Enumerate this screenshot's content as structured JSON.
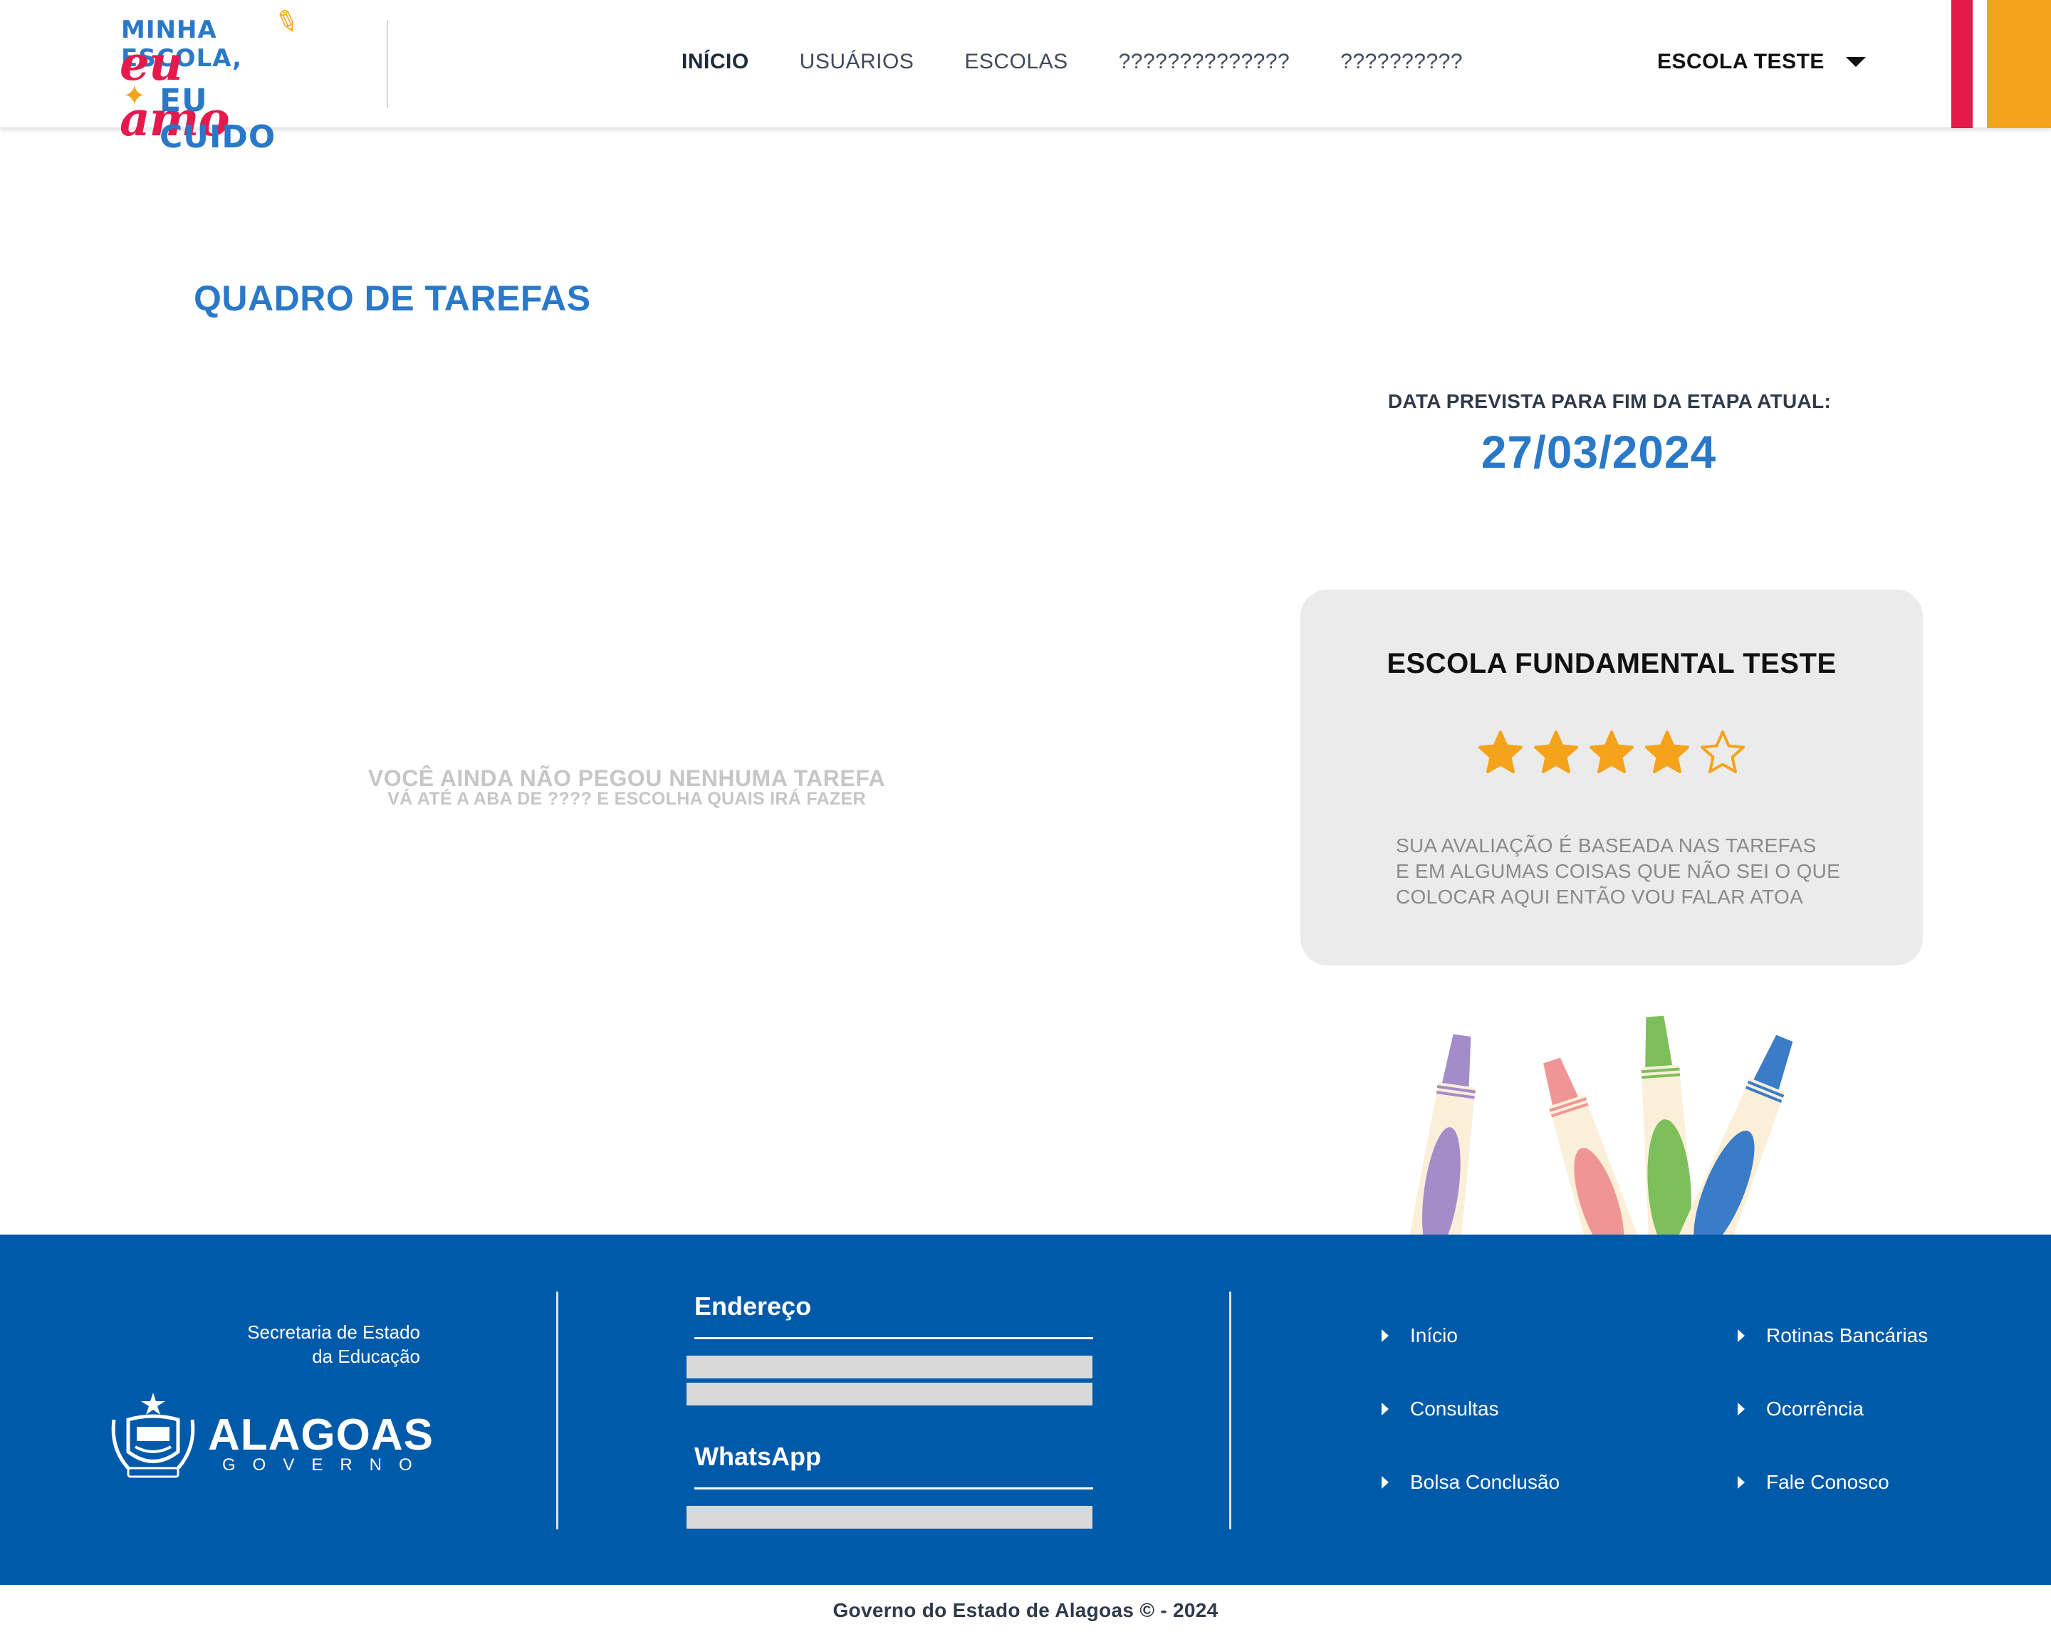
{
  "header": {
    "logo": {
      "line1": "MINHA ESCOLA,",
      "line2": "eu amo",
      "line3": "EU CUIDO"
    },
    "nav": [
      {
        "label": "INÍCIO",
        "active": true
      },
      {
        "label": "USUÁRIOS",
        "active": false
      },
      {
        "label": "ESCOLAS",
        "active": false
      },
      {
        "label": "??????????????",
        "active": false
      },
      {
        "label": "??????????",
        "active": false
      }
    ],
    "school_selector": {
      "label": "ESCOLA TESTE",
      "icon": "caret-down-icon"
    },
    "accent_colors": {
      "red": "#e5194c",
      "orange": "#f5a31a"
    }
  },
  "main": {
    "title": "QUADRO DE TAREFAS",
    "empty_state": {
      "title": "VOCÊ AINDA NÃO PEGOU NENHUMA TAREFA",
      "subtitle": "VÁ ATÉ A ABA DE ???? E ESCOLHA QUAIS IRÁ FAZER"
    },
    "deadline": {
      "label": "DATA PREVISTA PARA FIM DA ETAPA ATUAL:",
      "value": "27/03/2024"
    },
    "rating_card": {
      "school_name": "ESCOLA FUNDAMENTAL TESTE",
      "rating": 4,
      "max_rating": 5,
      "description_lines": [
        "SUA AVALIAÇÃO É BASEADA NAS TAREFAS",
        "E EM ALGUMAS COISAS QUE NÃO SEI O QUE",
        "COLOCAR AQUI ENTÃO VOU FALAR ATOA"
      ]
    },
    "colors": {
      "primary": "#2a78c8",
      "star": "#f5a31a"
    }
  },
  "footer": {
    "secretaria": [
      "Secretaria de Estado",
      "da Educação"
    ],
    "government": {
      "name": "ALAGOAS",
      "sub": "GOVERNO"
    },
    "contact": {
      "address_heading": "Endereço",
      "whatsapp_heading": "WhatsApp"
    },
    "links": [
      {
        "label": "Início"
      },
      {
        "label": "Consultas"
      },
      {
        "label": "Bolsa Conclusão"
      },
      {
        "label": "Rotinas Bancárias"
      },
      {
        "label": "Ocorrência"
      },
      {
        "label": "Fale Conosco"
      }
    ],
    "background": "#005aaa"
  },
  "copyright": "Governo do Estado de Alagoas © - 2024"
}
